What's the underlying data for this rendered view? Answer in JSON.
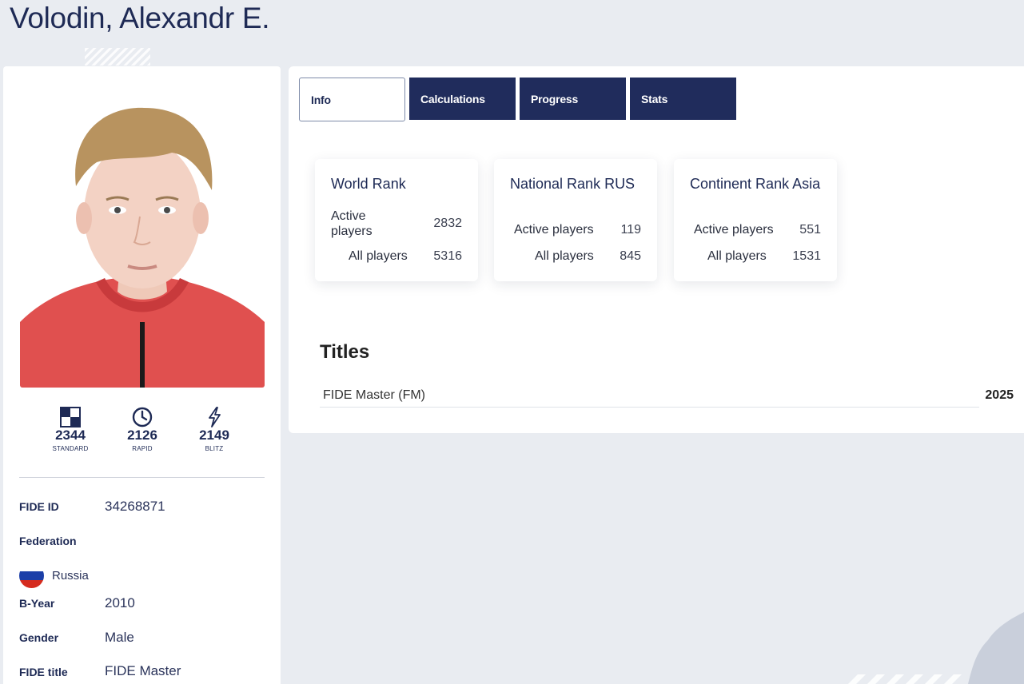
{
  "player": {
    "name": "Volodin, Alexandr E."
  },
  "ratings": [
    {
      "label": "STANDARD",
      "value": "2344",
      "icon": "chessboard-icon"
    },
    {
      "label": "RAPID",
      "value": "2126",
      "icon": "clock-icon"
    },
    {
      "label": "BLITZ",
      "value": "2149",
      "icon": "lightning-icon"
    }
  ],
  "details": {
    "fide_id_label": "FIDE ID",
    "fide_id": "34268871",
    "federation_label": "Federation",
    "federation": "Russia",
    "byear_label": "B-Year",
    "byear": "2010",
    "gender_label": "Gender",
    "gender": "Male",
    "title_label": "FIDE title",
    "title": "FIDE Master"
  },
  "tabs": [
    {
      "label": "Info",
      "active": true
    },
    {
      "label": "Calculations",
      "active": false
    },
    {
      "label": "Progress",
      "active": false
    },
    {
      "label": "Stats",
      "active": false
    }
  ],
  "ranks": [
    {
      "title": "World Rank",
      "active_label": "Active players",
      "active_value": "2832",
      "all_label": "All players",
      "all_value": "5316"
    },
    {
      "title": "National Rank RUS",
      "active_label": "Active players",
      "active_value": "119",
      "all_label": "All players",
      "all_value": "845"
    },
    {
      "title": "Continent Rank Asia",
      "active_label": "Active players",
      "active_value": "551",
      "all_label": "All players",
      "all_value": "1531"
    }
  ],
  "titles": {
    "heading": "Titles",
    "rows": [
      {
        "name": "FIDE Master (FM)",
        "year": "2025"
      }
    ]
  },
  "colors": {
    "navy": "#202c5c",
    "background": "#e9ecf1",
    "flag_white": "#ffffff",
    "flag_blue": "#1c3fa8",
    "flag_red": "#d52b1e"
  }
}
